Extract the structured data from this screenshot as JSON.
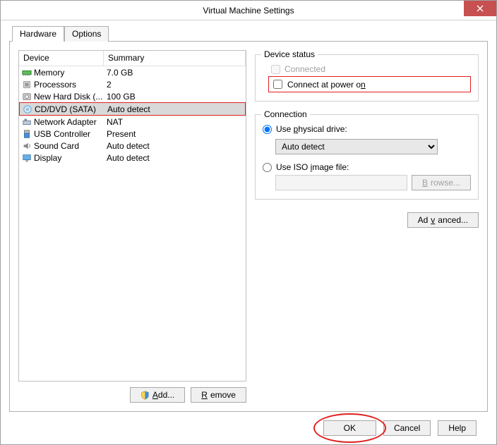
{
  "window": {
    "title": "Virtual Machine Settings"
  },
  "tabs": {
    "hardware": "Hardware",
    "options": "Options"
  },
  "columns": {
    "device": "Device",
    "summary": "Summary"
  },
  "devices": [
    {
      "icon": "memory",
      "name": "Memory",
      "summary": "7.0 GB"
    },
    {
      "icon": "cpu",
      "name": "Processors",
      "summary": "2"
    },
    {
      "icon": "disk",
      "name": "New Hard Disk (...",
      "summary": "100 GB"
    },
    {
      "icon": "cd",
      "name": "CD/DVD (SATA)",
      "summary": "Auto detect"
    },
    {
      "icon": "net",
      "name": "Network Adapter",
      "summary": "NAT"
    },
    {
      "icon": "usb",
      "name": "USB Controller",
      "summary": "Present"
    },
    {
      "icon": "sound",
      "name": "Sound Card",
      "summary": "Auto detect"
    },
    {
      "icon": "display",
      "name": "Display",
      "summary": "Auto detect"
    }
  ],
  "selected_index": 3,
  "buttons": {
    "add": "Add...",
    "remove": "Remove",
    "ok": "OK",
    "cancel": "Cancel",
    "help": "Help",
    "advanced": "Advanced...",
    "browse": "Browse..."
  },
  "device_status": {
    "title": "Device status",
    "connected": "Connected",
    "connect_power_on": "Connect at power on"
  },
  "connection": {
    "title": "Connection",
    "use_physical": "Use physical drive:",
    "physical_drive_value": "Auto detect",
    "use_iso": "Use ISO image file:",
    "iso_path": ""
  }
}
